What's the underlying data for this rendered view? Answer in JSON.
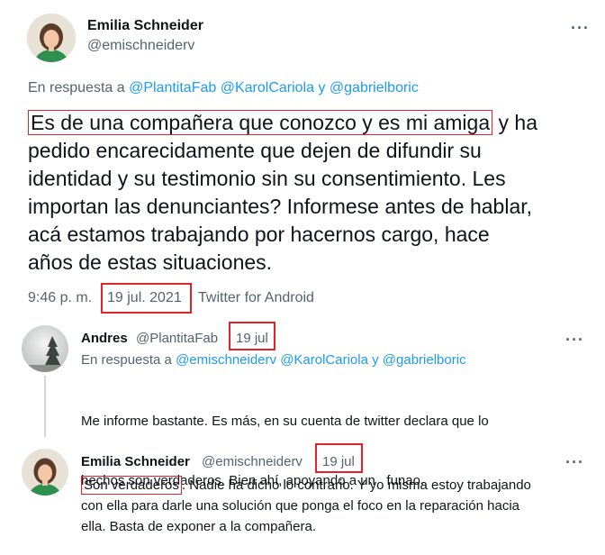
{
  "main_tweet": {
    "name": "Emilia Schneider",
    "handle": "@emischneiderv",
    "reply_prefix": "En respuesta a",
    "mentions": [
      "@PlantitaFab",
      "@KarolCariola",
      "y",
      "@gabrielboric"
    ],
    "body_highlight": "Es de una compañera que conozco y es mi amiga",
    "body_rest_line1": " y ha",
    "body_lines": [
      "pedido encarecidamente que dejen de difundir su",
      "identidad y su testimonio sin su consentimiento. Les",
      "importan las denunciantes? Informese antes de hablar,",
      "acá estamos trabajando por hacernos cargo, hace",
      "años de estas situaciones."
    ],
    "time": "9:46 p. m.",
    "date": "19 jul. 2021",
    "source": "Twitter for Android",
    "more_icon": "more-horizontal-icon"
  },
  "reply1": {
    "name": "Andres",
    "handle": "@PlantitaFab",
    "date": "19 jul",
    "reply_prefix": "En respuesta a",
    "mentions": [
      "@emischneiderv",
      "@KarolCariola",
      "y",
      "@gabrielboric"
    ],
    "body_lines": [
      "Me informe bastante. Es más, en su cuenta de twitter declara que lo",
      "hechos son verdaderos. Bien ahí, apoyando a un   funao."
    ]
  },
  "reply2": {
    "name": "Emilia Schneider",
    "handle": "@emischneiderv",
    "date": "19 jul",
    "body_highlight": "Son verdaderos",
    "body_rest_line1": ". Nadie ha dicho lo contrario. Y yo misma estoy trabajando",
    "body_lines": [
      "con ella para darle una solución que ponga el foco en la reparación hacia",
      "ella. Basta de exponer a la compañera."
    ]
  },
  "colors": {
    "link": "#1d9bf0",
    "muted": "#536471",
    "highlight_border": "#e0222a"
  }
}
